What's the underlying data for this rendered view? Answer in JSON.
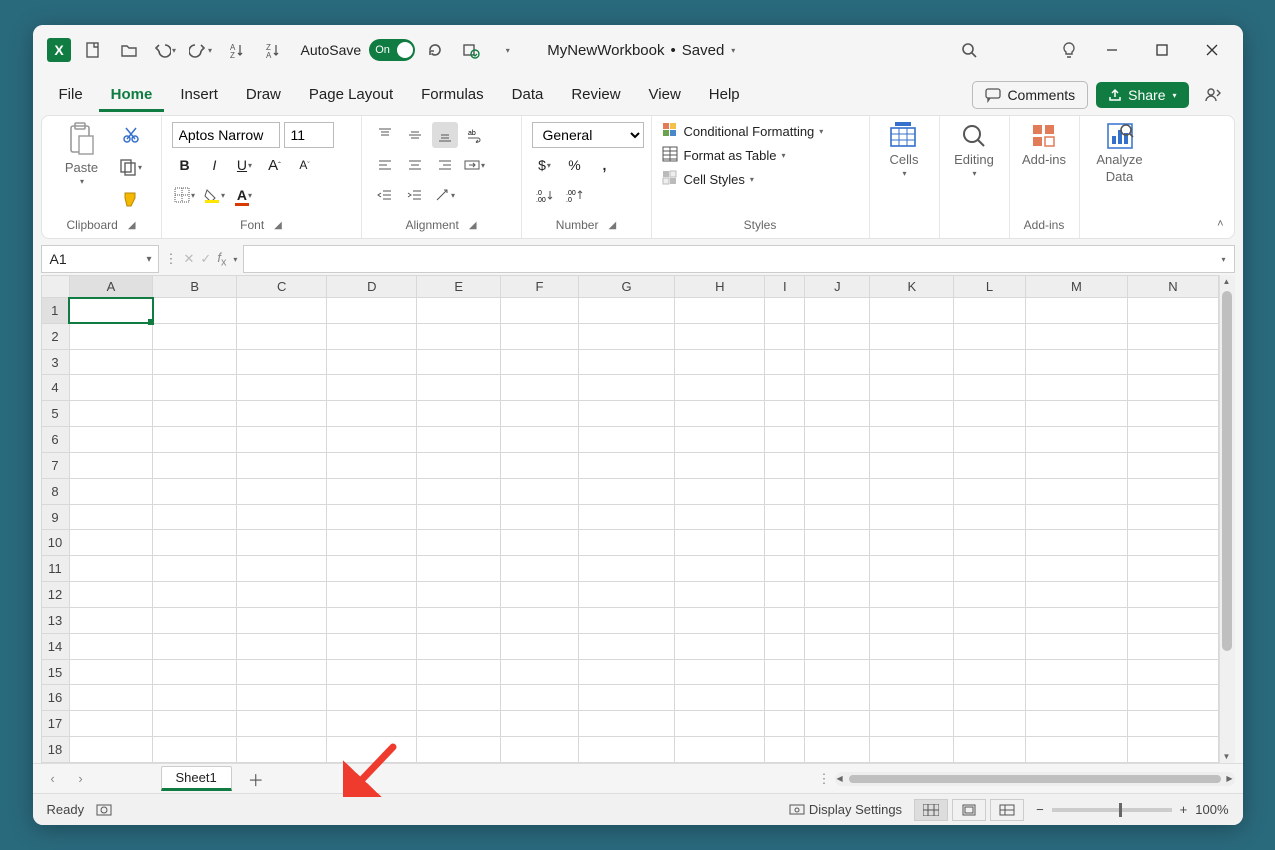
{
  "app": {
    "name": "Excel"
  },
  "titlebar": {
    "autosave_label": "AutoSave",
    "autosave_state": "On",
    "workbook": "MyNewWorkbook",
    "save_state": "Saved"
  },
  "tabs": {
    "items": [
      "File",
      "Home",
      "Insert",
      "Draw",
      "Page Layout",
      "Formulas",
      "Data",
      "Review",
      "View",
      "Help"
    ],
    "active": "Home",
    "comments": "Comments",
    "share": "Share"
  },
  "ribbon": {
    "clipboard": {
      "label": "Clipboard",
      "paste": "Paste"
    },
    "font": {
      "label": "Font",
      "name": "Aptos Narrow",
      "size": "11"
    },
    "alignment": {
      "label": "Alignment"
    },
    "number": {
      "label": "Number",
      "format": "General"
    },
    "styles": {
      "label": "Styles",
      "cond": "Conditional Formatting",
      "table": "Format as Table",
      "cell": "Cell Styles"
    },
    "cells": {
      "label": "Cells"
    },
    "editing": {
      "label": "Editing"
    },
    "addins": {
      "label": "Add-ins",
      "btn": "Add-ins"
    },
    "analyze": {
      "btn1": "Analyze",
      "btn2": "Data"
    }
  },
  "namebox": {
    "value": "A1"
  },
  "formula": {
    "value": ""
  },
  "grid": {
    "columns": [
      "A",
      "B",
      "C",
      "D",
      "E",
      "F",
      "G",
      "H",
      "I",
      "J",
      "K",
      "L",
      "M",
      "N"
    ],
    "rows": 18,
    "selected_cell": "A1"
  },
  "sheets": {
    "active": "Sheet1"
  },
  "status": {
    "ready": "Ready",
    "display_settings": "Display Settings",
    "zoom": "100%"
  }
}
